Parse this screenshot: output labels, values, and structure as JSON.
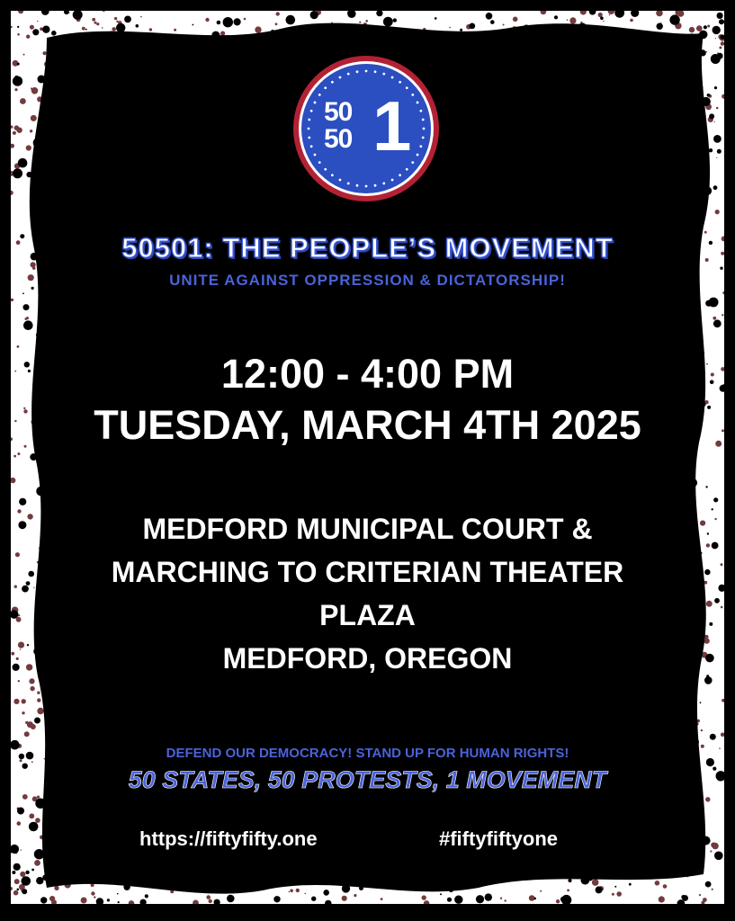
{
  "logo": {
    "top_number": "50\n50",
    "big_digit": "1",
    "colors": {
      "ring": "#b22234",
      "fill": "#2b4ec0",
      "dots": "#ffffff"
    }
  },
  "headline": "50501: THE PEOPLE’S MOVEMENT",
  "subline": "UNITE AGAINST OPPRESSION & DICTATORSHIP!",
  "event": {
    "time": "12:00 - 4:00 PM",
    "date": "TUESDAY, MARCH 4TH 2025"
  },
  "venue": [
    "MEDFORD MUNICIPAL COURT &",
    "MARCHING TO CRITERIAN THEATER",
    "PLAZA",
    "MEDFORD, OREGON"
  ],
  "slogan": "DEFEND OUR DEMOCRACY!  STAND UP FOR HUMAN RIGHTS!",
  "tagline": "50 STATES, 50 PROTESTS, 1 MOVEMENT",
  "url": "https://fiftyfifty.one",
  "hashtag": "#fiftyfiftyone",
  "colors": {
    "background": "#000000",
    "accent_blue": "#4a63d9",
    "splatter_red": "#5a1a1e",
    "frame": "#ffffff"
  }
}
